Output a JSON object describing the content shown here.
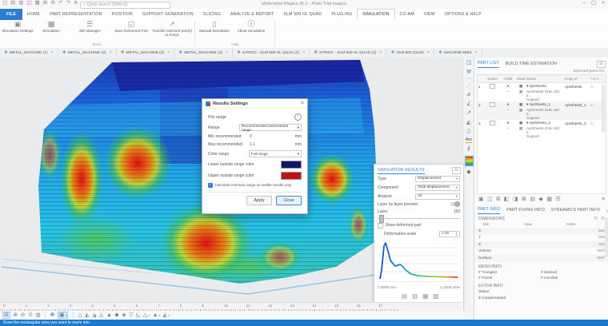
{
  "window": {
    "title": "Materialise Magics 26.2 - Plate Trial.magics",
    "search_placeholder": "Quick search (Shift+Q)",
    "controls": {
      "minimize": "–",
      "maximize": "▢",
      "close": "×"
    }
  },
  "icons": {
    "dropdown": "▾",
    "close": "×",
    "collapse": "⊟",
    "chevron_right": "›",
    "menu": "≡",
    "info": "i",
    "check": "✓",
    "expand": "▾",
    "eye": "∗",
    "plus": "+",
    "shade": "▦",
    "refresh_a": "↻",
    "refresh_b": "⟳",
    "search_hint": "⌕"
  },
  "ribbon": {
    "file_tab": "FILE",
    "tabs": [
      "HOME",
      "PART REPRESENTATION",
      "POSITION",
      "SUPPORT GENERATION",
      "SLICING",
      "ANALYZE & REPORT",
      "SLM 500 HL QUAD",
      "PLUG INS",
      "SIMULATION",
      "CO-AM",
      "VIEW",
      "OPTIONS & HELP"
    ],
    "active_tab": "SIMULATION",
    "groups": [
      {
        "label": "Basic",
        "buttons": [
          "Simulation Settings",
          "Simulation",
          "Job Manager",
          "Save Deformed Part",
          "Transfer selected part(s) to Ansys"
        ]
      },
      {
        "label": "Help",
        "buttons": [
          "Manual Simulation",
          "About Simulation"
        ]
      }
    ]
  },
  "document_tabs": [
    "METAL_MACHINE (1)",
    "METAL_MACHINE (2)",
    "METAL_MACHINE (3)",
    "METAL_MACHINE (4)",
    "8.PROC - SLM 500 HL QUAD (1)",
    "8.PROC - SLM 500 HL QUAD (2)",
    "SLM 500 QUAD",
    "MACHINE MMS"
  ],
  "part_list": {
    "tabs": [
      "PART LIST",
      "BUILD TIME ESTIMATION"
    ],
    "active_tab": "PART LIST",
    "selected_parts": "Selected parts  0/3",
    "columns": {
      "num": "",
      "select": "Select",
      "visible": "Visibl",
      "shade": "Shad",
      "name": "Name",
      "copy_of": "Copy of",
      "form": "Form"
    },
    "rows": [
      {
        "num": "1",
        "name": "AprSheets",
        "support_line1": "AprSheets 316L Std 2...",
        "support_line2": "Support",
        "copy_of": "AprSheets",
        "form": "A..."
      },
      {
        "num": "2",
        "name": "AprSheets_1",
        "support_line1": "AprSheets 316L Std 2...",
        "support_line2": "Support",
        "copy_of": "AprSheets_1",
        "form": "A..."
      },
      {
        "num": "3",
        "name": "AprSheets_2",
        "support_line1": "AprSheets 316L Std 2...",
        "support_line2": "Support",
        "copy_of": "AprSheets_2",
        "form": "A..."
      }
    ]
  },
  "part_info": {
    "tabs": [
      "PART INFO",
      "PART FIXING INFO",
      "STREAMICS PART INFO"
    ],
    "active_tab": "PART INFO",
    "dimensions": {
      "title": "DIMENSIONS",
      "columns": [
        "Min",
        "Max",
        "Delta"
      ],
      "rows": [
        {
          "label": "X",
          "unit": "mm"
        },
        {
          "label": "Y",
          "unit": "mm"
        },
        {
          "label": "Z",
          "unit": "mm"
        },
        {
          "label": "Volume",
          "unit": "mm³"
        },
        {
          "label": "Surface",
          "unit": "mm²"
        }
      ]
    },
    "mesh_info": {
      "title": "MESH INFO",
      "items": [
        "# Triangles",
        "# Marked",
        "# Points",
        "# Invisible"
      ]
    },
    "extra_info": {
      "title": "EXTRA INFO",
      "status_label": "Status",
      "status_value": "Z Compensated"
    }
  },
  "simulation_results": {
    "title": "SIMULATION RESULTS",
    "type_label": "Type",
    "type_value": "Displacement",
    "component_label": "Component",
    "component_value": "Total displacement",
    "analyze_label": "Analyze",
    "analyze_value": "All",
    "layer_preview_label": "Layer by layer preview",
    "layer_label": "Layer",
    "layer_value": "110",
    "show_deformed_label": "Show deformed part",
    "deformation_scale_label": "Deformation scale",
    "deformation_scale_value": "1.00",
    "range_min": "0.0000 mm",
    "range_max": "1.1000 mm",
    "chart_data": {
      "type": "line",
      "x_range_mm": [
        0.0,
        1.1
      ],
      "x": [
        0.0,
        0.04,
        0.08,
        0.11,
        0.14,
        0.18,
        0.24,
        0.3,
        0.33,
        0.38,
        0.46,
        0.55,
        0.7,
        0.9,
        1.1
      ],
      "y_relative": [
        0.05,
        0.25,
        0.92,
        1.0,
        0.8,
        0.55,
        0.38,
        0.42,
        0.38,
        0.28,
        0.18,
        0.13,
        0.1,
        0.09,
        0.08
      ],
      "colormap": "blue-to-red along x"
    }
  },
  "results_dialog": {
    "title": "Results Settings",
    "plot_range_label": "Plot range",
    "range_label": "Range",
    "range_value": "Recommended assessment range",
    "min_label": "Min recommended",
    "min_value": "0",
    "min_unit": "mm",
    "max_label": "Max recommended",
    "max_value": "1.1",
    "max_unit": "mm",
    "color_range_label": "Color range",
    "color_range_value": "Full range",
    "lower_color_label": "Lower outside range color",
    "lower_color": "#14146a",
    "upper_color_label": "Upper outside range color",
    "upper_color": "#c41111",
    "checkbox_label": "Calculate min/max range on visible results only",
    "apply_label": "Apply",
    "close_label": "Close"
  },
  "right_toolstrip": [
    "view-cube",
    "wrench-tool",
    "measure-distance",
    "measure-diameter",
    "measure-angle",
    "measure-line",
    "scenes",
    "new-document",
    "text-annotation",
    "attachment",
    "simulation-colormap",
    "deformed-part"
  ],
  "bottom": {
    "ruler_numbers": [
      "0",
      "1",
      "2",
      "3",
      "4",
      "5",
      "6",
      "7",
      "8",
      "9",
      "10",
      "11",
      "12",
      "13",
      "14",
      "15",
      "16",
      "17"
    ],
    "status_text": "Draw the rectangular area you want to zoom into."
  },
  "colors": {
    "accent_blue": "#2e8ae6",
    "file_tab_blue": "#2b7cd3",
    "status_bar": "#1879d0",
    "lower_swatch": "#14146a",
    "upper_swatch": "#c41111"
  }
}
